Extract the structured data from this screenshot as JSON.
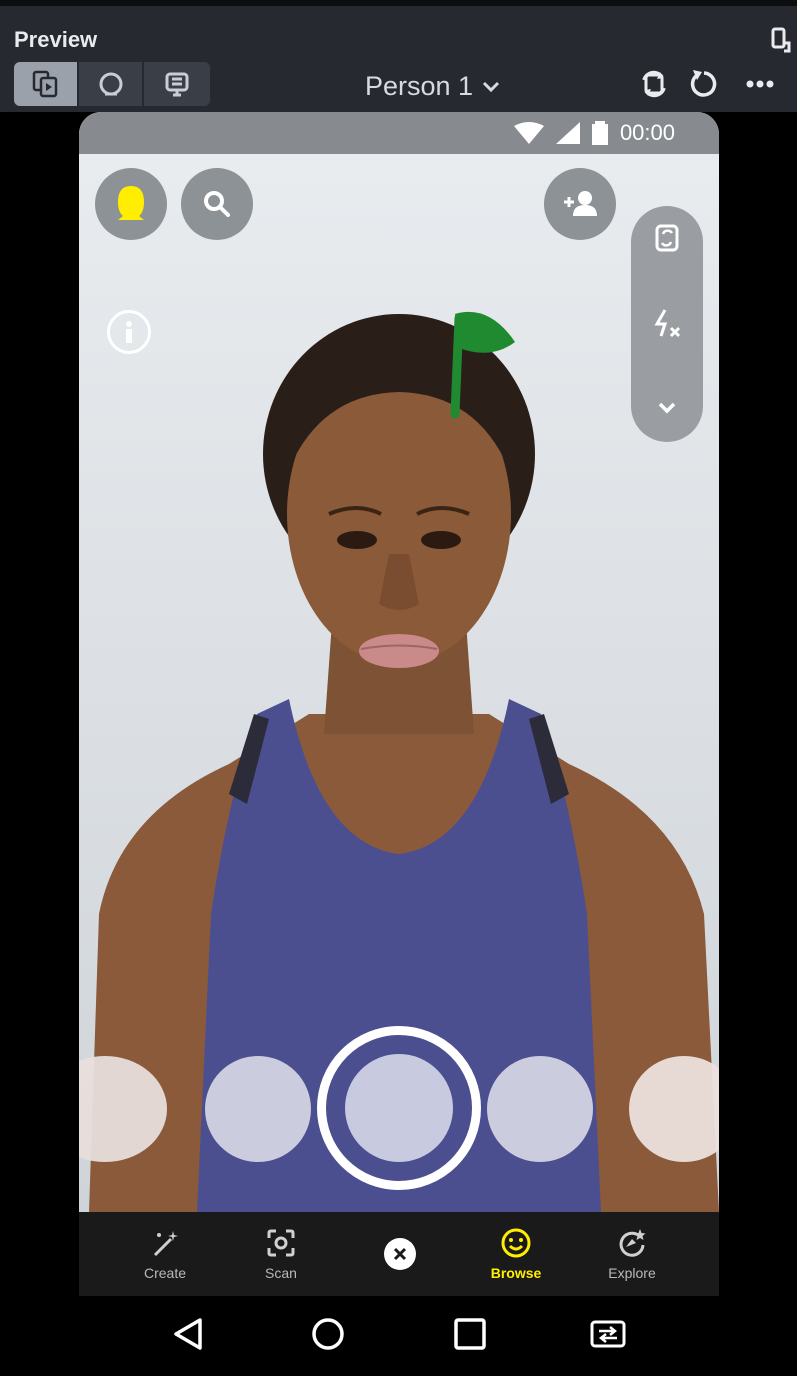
{
  "panel": {
    "title": "Preview",
    "person_selector": "Person 1",
    "mode_buttons": [
      "preview-mode-icon",
      "camera-mode-icon",
      "capture-mode-icon"
    ],
    "actions": [
      "switch-camera-icon",
      "reload-icon",
      "more-icon"
    ]
  },
  "status_bar": {
    "time": "00:00",
    "icons": [
      "wifi-icon",
      "signal-icon",
      "battery-icon"
    ]
  },
  "camera_ui": {
    "left_buttons": [
      "profile-icon",
      "search-icon"
    ],
    "info_icon": "info-icon",
    "add_friend_icon": "add-friend-icon",
    "side_tray": [
      "flip-camera-icon",
      "flash-off-icon",
      "chevron-down-icon"
    ]
  },
  "snap_nav": {
    "items": [
      {
        "label": "Create",
        "icon": "magic-wand-icon"
      },
      {
        "label": "Scan",
        "icon": "scan-icon"
      },
      {
        "label": "Browse",
        "icon": "smiley-icon"
      },
      {
        "label": "Explore",
        "icon": "explore-icon"
      }
    ],
    "close_icon": "close-icon"
  },
  "android_nav": [
    "back-icon",
    "home-icon",
    "recents-icon",
    "swap-icon"
  ],
  "colors": {
    "accent_yellow": "#ffee00",
    "panel_bg": "#262a30",
    "shirt": "#4c4f8f"
  }
}
